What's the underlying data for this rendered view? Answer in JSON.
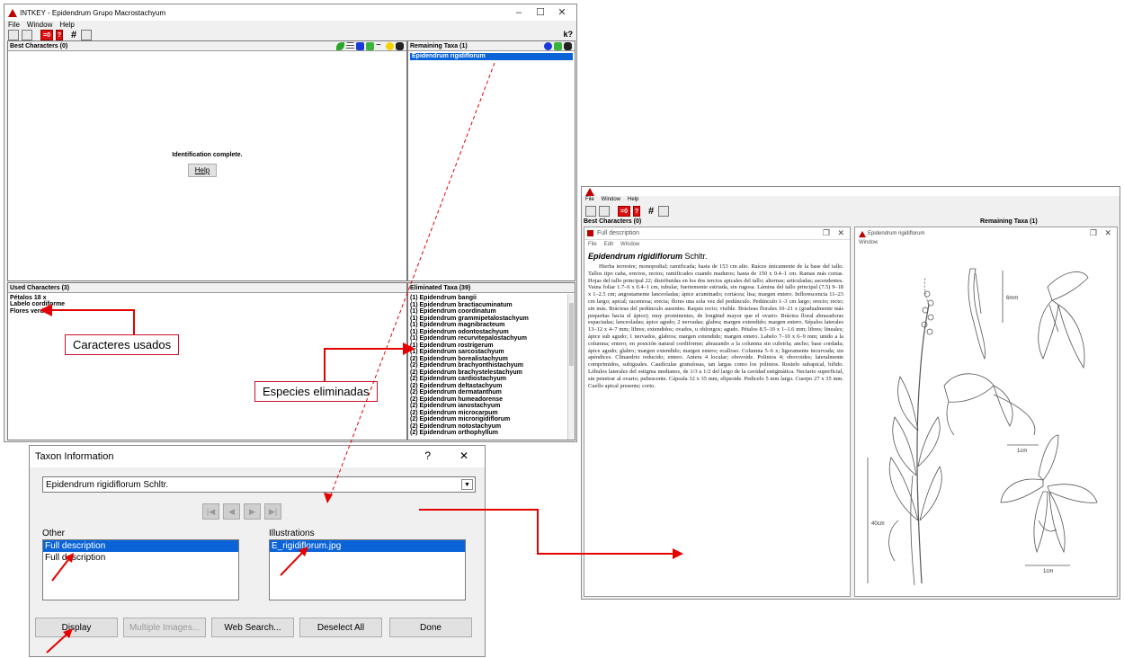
{
  "main_window": {
    "title": "INTKEY - Epidendrum Grupo Macrostachyum",
    "menu": [
      "File",
      "Window",
      "Help"
    ],
    "toolbar": {
      "counter": "=0",
      "hash": "#"
    },
    "best_characters_header": "Best Characters (0)",
    "remaining_taxa_header": "Remaining Taxa (1)",
    "remaining_taxa": [
      "Epidendrum rigidiflorum"
    ],
    "identification_message": "Identification complete.",
    "help_button": "Help",
    "used_characters_header": "Used Characters (3)",
    "used_characters": [
      "Pétalos 18 x",
      "Labelo cordiforme",
      "Flores verdes"
    ],
    "eliminated_taxa_header": "Eliminated Taxa (39)",
    "eliminated_taxa": [
      "(1) Epidendrum bangii",
      "(1) Epidendrum bractiacuminatum",
      "(1) Epidendrum coordinatum",
      "(1) Epidendrum grammipetalostachyum",
      "(1) Epidendrum magnibracteum",
      "(1) Epidendrum odontostachyum",
      "(1) Epidendrum recurvitepalostachyum",
      "(1) Epidendrum rostrigerum",
      "(1) Epidendrum sarcostachyum",
      "(2) Epidendrum borealistachyum",
      "(2) Epidendrum brachyonthistachyum",
      "(2) Epidendrum brachystelestachyum",
      "(2) Epidendrum cardiostachyum",
      "(2) Epidendrum deltastachyum",
      "(2) Epidendrum dermatanthum",
      "(2) Epidendrum humeadorense",
      "(2) Epidendrum ianostachyum",
      "(2) Epidendrum microcarpum",
      "(2) Epidendrum microrigidiflorum",
      "(2) Epidendrum notostachyum",
      "(2) Epidendrum orthophyllum"
    ]
  },
  "callouts": {
    "used": "Caracteres usados",
    "eliminated": "Especies eliminadas"
  },
  "taxon_dialog": {
    "title": "Taxon Information",
    "help": "?",
    "close": "✕",
    "selected_taxon": "Epidendrum rigidiflorum Schltr.",
    "other_label": "Other",
    "other_items": [
      "Full description",
      "Full description"
    ],
    "illustrations_label": "Illustrations",
    "illustration_items": [
      "E_rigidiflorum.jpg"
    ],
    "buttons": {
      "display": "Display",
      "multiple_images": "Multiple Images...",
      "web_search": "Web Search...",
      "deselect_all": "Deselect All",
      "done": "Done"
    }
  },
  "second_window": {
    "menu": [
      "File",
      "Window",
      "Help"
    ],
    "best_characters_header": "Best Characters (0)",
    "remaining_taxa_header": "Remaining Taxa (1)",
    "full_description_title": "Full description",
    "full_description_menu": [
      "File",
      "Edit",
      "Window"
    ],
    "species_name": "Epidendrum rigidiflorum",
    "species_author": "Schltr.",
    "description": "Hierba terrestre; monopodial; ramificada; hasta de 153 cm alto. Raíces únicamente de la base del tallo. Tallos tipo caña, erectos, rectos; ramificados cuando maduros; hasta de 150 x 0.4–1 cm. Ramas más cortas. Hojas del tallo principal 22; distribuidas en los dos tercios apicales del tallo; alternas; articuladas; ascendentes. Vaina foliar 1.7–6 x 0.4–1 cm, tubular, fuertemente estriada, sin rugosa. Lámina del tallo principal (7.5) 9–18 x 1–2.5 cm; angostamente lanceoladas; ápice acuminado; coriácea; lisa; margen entero. Inflorescencia 11–23 cm largo; apical; racemosa; erecta; flores una sola vez del pedúnculo. Pedúnculo 1–3 cm largo; erecto; recto; sin más. Brácteas del pedúnculo ausentes. Raquis recto; visible. Brácteas florales 10–21 x (gradualmente más pequeñas hacia el ápice); muy prominentes, de longitud mayor que el ovario. Bráctea floral abrazadoras espaciadas; lanceoladas; ápice agudo; 2 nervadas; glabra; margen extendido; margen entero. Sépalos laterales 13–12 x 4–7 mm; libres; extendidos; ovados, u oblongos; agudo. Pétalos 8.5–10 x 1–1.6 mm; libres; lineales; ápice sub agudo; 1 nervados, glabros; margen extendido; margen entero. Labelo 7–10 x 6–9 mm; unido a la columna; entero; en posición natural cordiforme; abrazando a la columna sin cubrirla; ancho; base cordada; ápice agudo; glabro; margen extendido; margen entero; ecalloso. Columna 5–6 x; ligeramente incurvada; sin apéndices. Clinandrio reducido; entero. Antera 4 locular; obovoide. Polinios 4; obovoides; lateralmente comprimidos, subiguales. Caudículas granulosas, tan largas como los polinios. Rostelo subapical, bífido. Lóbulos laterales del estigma medianos, de 1/3 a 1/2 del largo de la cavidad estigmática. Nectario superficial, sin penetrar al ovario; pubescente. Cápsula 32 x 35 mm; elipsoide. Pedicelo 5 mm largo. Cuerpo 27 x 35 mm. Cuello apical presente; corto.",
    "image_window_title": "Epidendrum rigidiflorum",
    "image_window_menu": "Window",
    "image_labels": [
      "6mm",
      "40cm",
      "1cm",
      "1cm"
    ]
  },
  "colors": {
    "selection": "#0a64d8",
    "annotation_red": "#e50000",
    "icon_red": "#c00000"
  }
}
